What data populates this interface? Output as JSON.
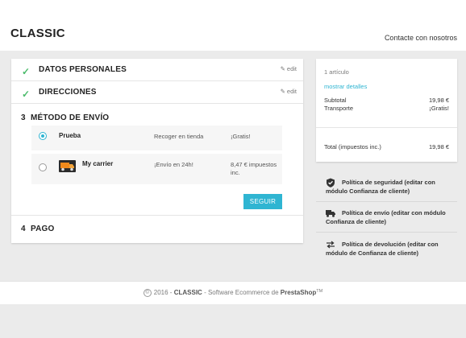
{
  "header": {
    "logo": "CLASSIC",
    "contact_link": "Contacte con nosotros"
  },
  "checkout": {
    "steps": [
      {
        "title": "DATOS PERSONALES",
        "edit_label": "edit",
        "status": "complete"
      },
      {
        "title": "DIRECCIONES",
        "edit_label": "edit",
        "status": "complete"
      },
      {
        "number": "3",
        "title": "MÉTODO DE ENVÍO",
        "status": "current"
      },
      {
        "number": "4",
        "title": "PAGO",
        "status": "pending"
      }
    ],
    "carriers": [
      {
        "name": "Prueba",
        "delay": "Recoger en tienda",
        "price": "¡Gratis!",
        "selected": true
      },
      {
        "name": "My carrier",
        "delay": "¡Envío en 24h!",
        "price": "8,47 € impuestos inc.",
        "selected": false,
        "logo_icon": "truck-icon"
      }
    ],
    "continue_label": "SEGUIR"
  },
  "cart_summary": {
    "count": "1 artículo",
    "details_link": "mostrar detalles",
    "subtotal_label": "Subtotal",
    "subtotal_value": "19,98 €",
    "shipping_label": "Transporte",
    "shipping_value": "¡Gratis!",
    "total_label": "Total (impuestos inc.)",
    "total_value": "19,98 €"
  },
  "reassurance": [
    {
      "icon": "shield-icon",
      "text": "Política de seguridad (editar con módulo Confianza de cliente)"
    },
    {
      "icon": "truck-icon",
      "text": "Política de envío (editar con módulo Confianza de cliente)"
    },
    {
      "icon": "swap-arrows-icon",
      "text": "Política de devolución (editar con módulo de Confianza de cliente)"
    }
  ],
  "footer": {
    "year": "2016",
    "separator1": "-",
    "shop": "CLASSIC",
    "separator2": "-",
    "software": "Software Ecommerce de",
    "brand": "PrestaShop",
    "tm": "TM"
  },
  "colors": {
    "accent": "#2fb5d2",
    "check": "#4cbb6c",
    "background": "#ebebeb"
  }
}
